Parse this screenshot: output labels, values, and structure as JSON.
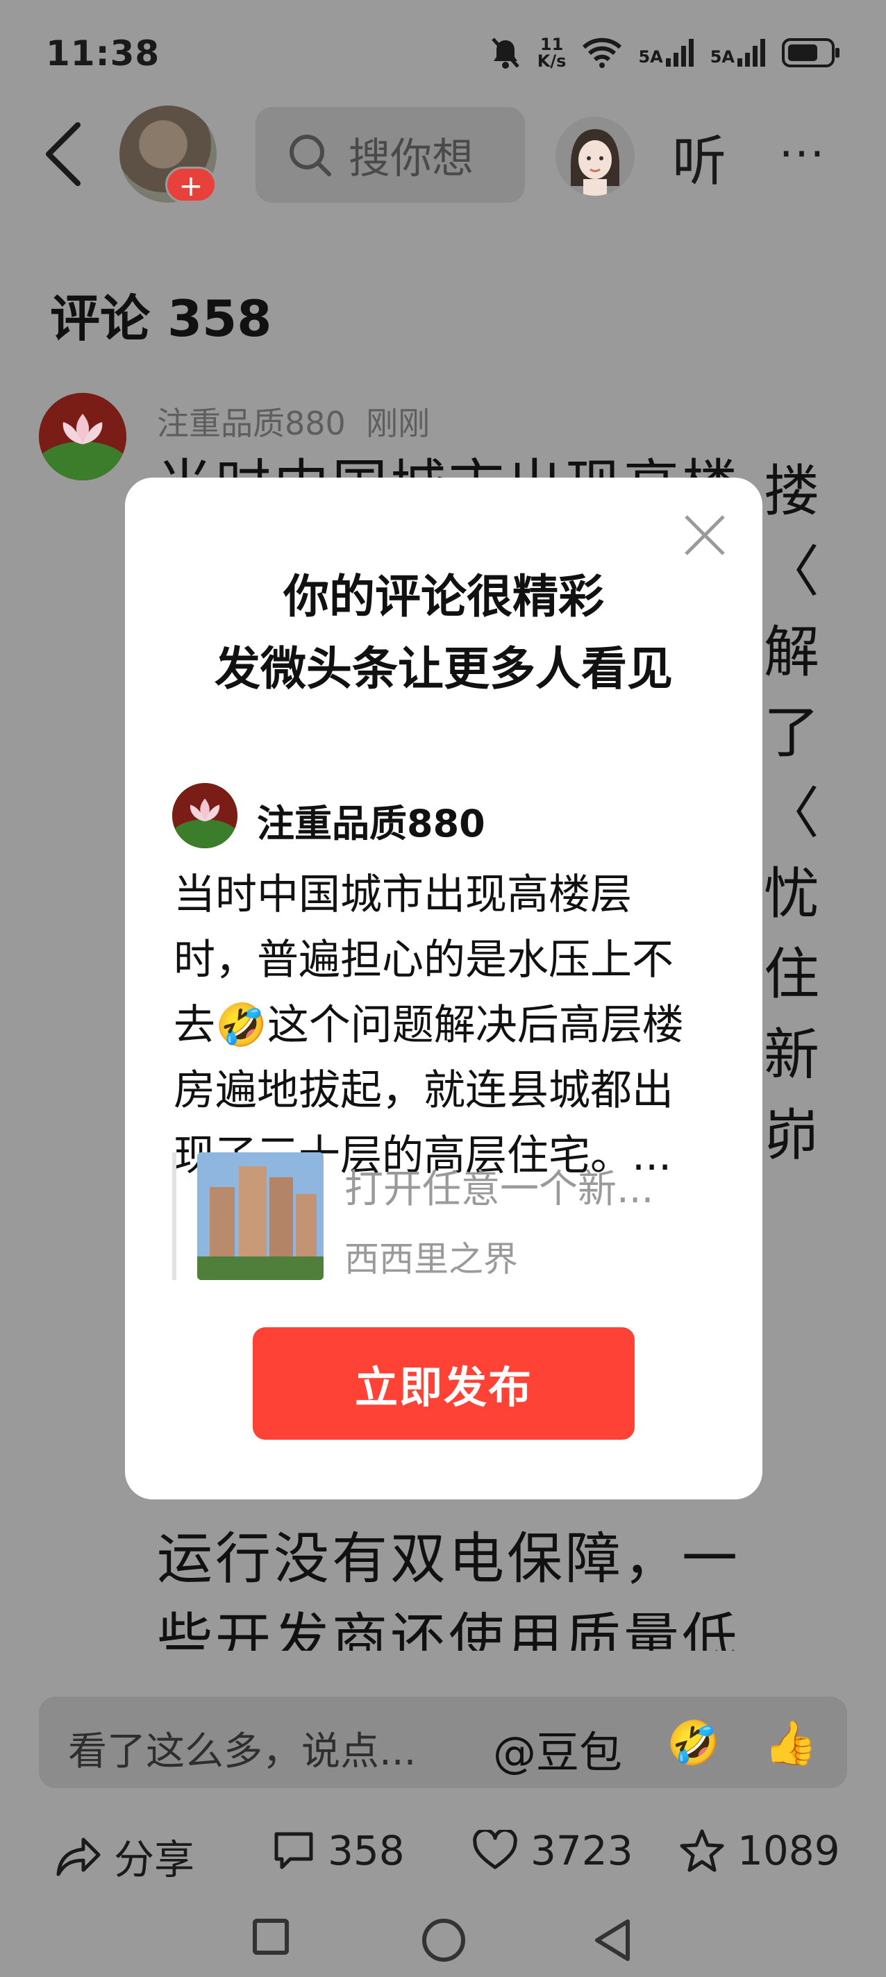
{
  "status_bar": {
    "time": "11:38",
    "net_speed_value": "11",
    "net_speed_unit": "K/s",
    "signal1_label": "5A",
    "signal2_label": "5A",
    "icons": [
      "mute-icon",
      "wifi-icon",
      "signal-icon",
      "signal-icon",
      "battery-icon"
    ]
  },
  "header": {
    "search_placeholder": "搜你想",
    "listen_label": "听",
    "more_label": "···"
  },
  "comments": {
    "title": "评论 358",
    "first": {
      "username": "注重品质880",
      "time": "刚刚",
      "visible_lines": [
        "",
        "",
        "",
        "",
        "",
        "",
        "",
        "",
        "运行没有双电保障，一",
        "些开发商还使用质量低"
      ],
      "peek_chars": [
        "搂",
        "〈",
        "解",
        "",
        "了",
        "〈",
        "忧",
        "住",
        "新",
        "峁"
      ]
    }
  },
  "modal": {
    "title_line1": "你的评论很精彩",
    "title_line2": "发微头条让更多人看见",
    "preview_username": "注重品质880",
    "preview_lines": [
      "当时中国城市出现高楼层",
      "时，普遍担心的是水压上不",
      "去这个问题解决后高层楼",
      "房遍地拔起，就连县城都出",
      "现了三十层的高层住宅。..."
    ],
    "quote_title": "打开任意一个新...",
    "quote_source": "西西里之界",
    "publish_label": "立即发布"
  },
  "comment_bar": {
    "placeholder": "看了这么多，说点...",
    "mention": "@豆包",
    "emoji1": "🤣",
    "emoji2": "👍"
  },
  "actions": {
    "share_label": "分享",
    "comments_count": "358",
    "likes_count": "3723",
    "favorites_count": "1089"
  },
  "colors": {
    "accent_red": "#ff4236",
    "overlay_gray": "#9a9a9a"
  }
}
